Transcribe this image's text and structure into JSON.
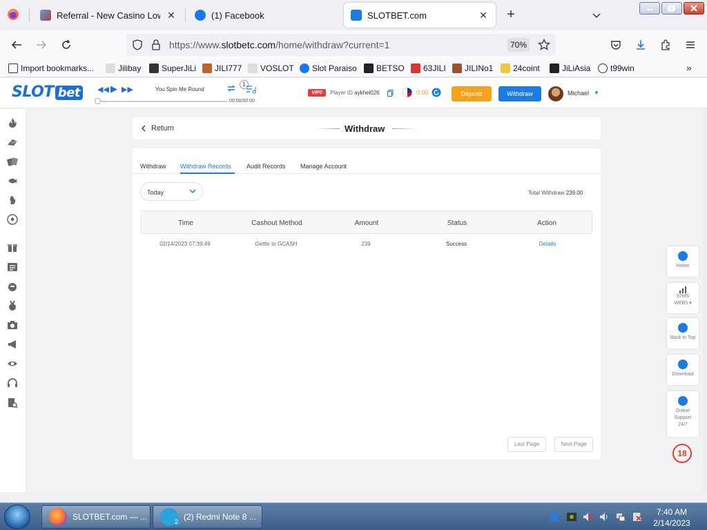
{
  "browser": {
    "tabs": [
      {
        "label": "Referral - New Casino LowTurno"
      },
      {
        "label": "(1) Facebook"
      },
      {
        "label": "SLOTBET.com"
      }
    ],
    "url_prefix": "https://www.",
    "url_domain": "slotbetc.com",
    "url_path": "/home/withdraw?current=1",
    "zoom": "70%",
    "bookmarks": [
      {
        "label": "Import bookmarks..."
      },
      {
        "label": "Jilibay"
      },
      {
        "label": "SuperJiLi"
      },
      {
        "label": "JILI777"
      },
      {
        "label": "VOSLOT"
      },
      {
        "label": "Slot Paraiso"
      },
      {
        "label": "BETSO"
      },
      {
        "label": "63JILI"
      },
      {
        "label": "JILINo1"
      },
      {
        "label": "24coint"
      },
      {
        "label": "JiLiAsia"
      },
      {
        "label": "t99win"
      }
    ]
  },
  "header": {
    "logo_slot": "SLOT",
    "logo_bet": "bet",
    "song_title": "You Spin Me Round",
    "playlist_count": "1",
    "time": "00:00/00:00",
    "vip": "VIP0",
    "player_id_label": "Player ID",
    "player_id": "aykhel026",
    "balance": "0.00",
    "deposit": "Deposit",
    "withdraw": "Withdraw",
    "username": "Michael"
  },
  "page": {
    "return": "Return",
    "title": "Withdraw",
    "tabs": [
      "Withdraw",
      "Withdraw Records",
      "Audit Records",
      "Manage Account"
    ],
    "filter": "Today",
    "total_label": "Total Withdraw",
    "total_value": "239.00",
    "columns": [
      "Time",
      "Cashout Method",
      "Amount",
      "Status",
      "Action"
    ],
    "rows": [
      {
        "time": "02/14/2023 07:39:49",
        "method": "Gettle to GCASH",
        "amount": "239",
        "status": "Success",
        "action": "Details"
      }
    ],
    "last_page": "Last Page",
    "next_page": "Next Page"
  },
  "floats": {
    "home": "Home",
    "ping": "97MS",
    "web": "WEB5",
    "back_to_top": "Back to Top",
    "download": "Download",
    "support_1": "Online",
    "support_2": "Support",
    "support_3": "24/7",
    "age": "18"
  },
  "taskbar": {
    "task1": "SLOTBET.com — ...",
    "task2": "(2) Redmi Note 8 ...",
    "task2_badge": "2",
    "time": "7:40 AM",
    "date": "2/14/2023"
  },
  "colors": {
    "brand": "#1c7be0",
    "deposit": "#f7a21b",
    "vip": "#e43e3e"
  }
}
